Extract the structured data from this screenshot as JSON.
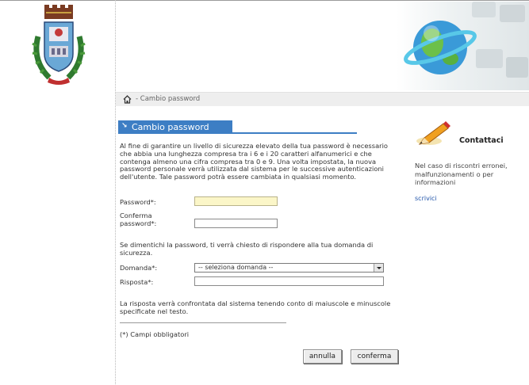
{
  "breadcrumb": {
    "text": "- Cambio password"
  },
  "section": {
    "title": "Cambio password"
  },
  "intro": "Al fine di garantire un livello di sicurezza elevato della tua password è necessario che abbia una lunghezza compresa tra i 6 e i 20 caratteri alfanumerici e che contenga almeno una cifra compresa tra 0 e 9. Una volta impostata, la nuova password personale verrà utilizzata dal sistema per le successive autenticazioni dell'utente. Tale password potrà essere cambiata in qualsiasi momento.",
  "fields": {
    "password_label": "Password*:",
    "password_value": "",
    "confirm_label": "Conferma password*:",
    "confirm_value": "",
    "domanda_label": "Domanda*:",
    "domanda_selected": "-- seleziona domanda --",
    "risposta_label": "Risposta*:",
    "risposta_value": ""
  },
  "security_note": "Se dimentichi la password, ti verrà chiesto di rispondere alla tua domanda di sicurezza.",
  "case_note": "La risposta verrà confrontata dal sistema tenendo conto di maiuscole e minuscole specificate nel testo.",
  "required_note": "(*) Campi obbligatori",
  "buttons": {
    "cancel": "annulla",
    "confirm": "conferma"
  },
  "contact": {
    "title": "Contattaci",
    "text": "Nel caso di riscontri erronei, malfunzionamenti o per informazioni",
    "link": "scrivici"
  },
  "colors": {
    "accent": "#3d7ec4",
    "focus_field": "#fbf6c8",
    "breadcrumb_bg": "#eeeeee"
  }
}
